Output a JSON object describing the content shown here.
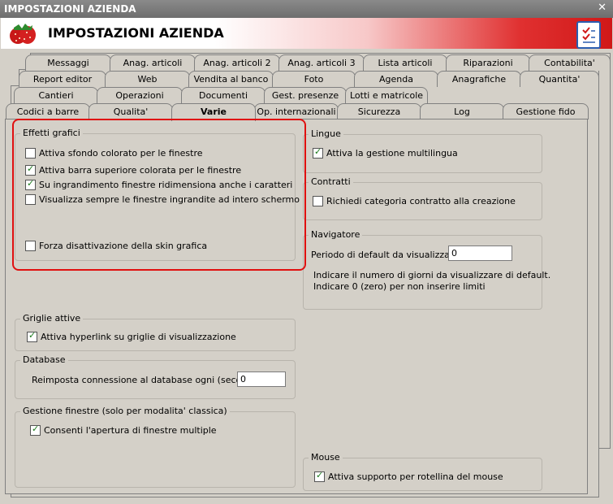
{
  "window": {
    "title": "IMPOSTAZIONI AZIENDA",
    "close_label": "✕"
  },
  "header": {
    "title": "IMPOSTAZIONI AZIENDA"
  },
  "tabs": {
    "row1": [
      "Messaggi",
      "Anag. articoli",
      "Anag. articoli 2",
      "Anag. articoli 3",
      "Lista articoli",
      "Riparazioni",
      "Contabilita'"
    ],
    "row2": [
      "Report editor",
      "Web",
      "Vendita al banco",
      "Foto",
      "Agenda",
      "Anagrafiche",
      "Quantita'"
    ],
    "row3": [
      "Cantieri",
      "Operazioni",
      "Documenti",
      "Gest. presenze",
      "Lotti e matricole"
    ],
    "row4": [
      "Codici a barre",
      "Qualita'",
      "Varie",
      "Op. internazionali",
      "Sicurezza",
      "Log",
      "Gestione fido"
    ],
    "active": "Varie"
  },
  "effetti": {
    "title": "Effetti grafici",
    "items": [
      {
        "label": "Attiva sfondo colorato per le finestre",
        "checked": false
      },
      {
        "label": "Attiva barra superiore colorata per le finestre",
        "checked": true
      },
      {
        "label": "Su ingrandimento finestre ridimensiona anche i caratteri",
        "checked": true
      },
      {
        "label": "Visualizza sempre le finestre ingrandite ad intero schermo",
        "checked": false
      },
      {
        "label": "Forza disattivazione della skin grafica",
        "checked": false
      }
    ]
  },
  "griglie": {
    "title": "Griglie attive",
    "label": "Attiva hyperlink su griglie di visualizzazione",
    "checked": true
  },
  "database": {
    "title": "Database",
    "label": "Reimposta connessione al database ogni (secondi) :",
    "value": "0"
  },
  "finestre": {
    "title": "Gestione finestre (solo per modalita' classica)",
    "label": "Consenti l'apertura di finestre multiple",
    "checked": true
  },
  "lingue": {
    "title": "Lingue",
    "label": "Attiva la gestione multilingua",
    "checked": true
  },
  "contratti": {
    "title": "Contratti",
    "label": "Richiedi categoria contratto alla creazione",
    "checked": false
  },
  "navigatore": {
    "title": "Navigatore",
    "label": "Periodo di default da visualizzare :",
    "value": "0",
    "note1": "Indicare il numero di giorni da visualizzare di default.",
    "note2": "Indicare 0 (zero) per non inserire limiti"
  },
  "mouse": {
    "title": "Mouse",
    "label": "Attiva supporto per rotellina del mouse",
    "checked": true
  },
  "colors": {
    "highlight": "#e01010",
    "check": "#1a7a1a",
    "header_red": "#d01818"
  }
}
